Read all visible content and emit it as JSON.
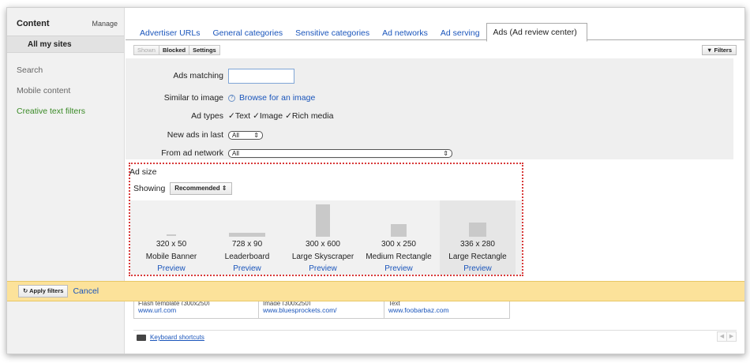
{
  "sidebar": {
    "title": "Content",
    "manage": "Manage",
    "all_sites": "All my sites",
    "items": [
      "Search",
      "Mobile content",
      "Creative text filters"
    ]
  },
  "tabs": [
    "Advertiser URLs",
    "General categories",
    "Sensitive categories",
    "Ad networks",
    "Ad serving",
    "Ads (Ad review center)"
  ],
  "subtabs": [
    "Shown",
    "Blocked",
    "Settings"
  ],
  "filters_button": "▼ Filters",
  "form": {
    "ads_matching_label": "Ads matching",
    "similar_label": "Similar to image",
    "browse_link": "Browse for an image",
    "ad_types_label": "Ad types",
    "ad_types": [
      "Text",
      "Image",
      "Rich media"
    ],
    "new_ads_label": "New ads in last",
    "new_ads_value": "All",
    "network_label": "From ad network",
    "network_value": "All"
  },
  "ad_size": {
    "title": "Ad size",
    "showing_label": "Showing",
    "showing_value": "Recommended ⇕",
    "preview_label": "Preview",
    "items": [
      {
        "dim": "320 x 50",
        "name": "Mobile Banner"
      },
      {
        "dim": "728 x 90",
        "name": "Leaderboard"
      },
      {
        "dim": "300 x 600",
        "name": "Large Skyscraper"
      },
      {
        "dim": "300 x 250",
        "name": "Medium Rectangle"
      },
      {
        "dim": "336 x 280",
        "name": "Large Rectangle"
      }
    ]
  },
  "apply": {
    "button": "↻ Apply filters",
    "cancel": "Cancel"
  },
  "results": [
    {
      "type": "Flash template (300x250)",
      "url": "www.url.com"
    },
    {
      "type": "Image (300x250)",
      "url": "www.bluesprockets.com/"
    },
    {
      "type": "Text",
      "url": "www.foobarbaz.com"
    }
  ],
  "keyboard_shortcuts": "Keyboard shortcuts",
  "pager": {
    "prev": "◀",
    "next": "▶"
  }
}
